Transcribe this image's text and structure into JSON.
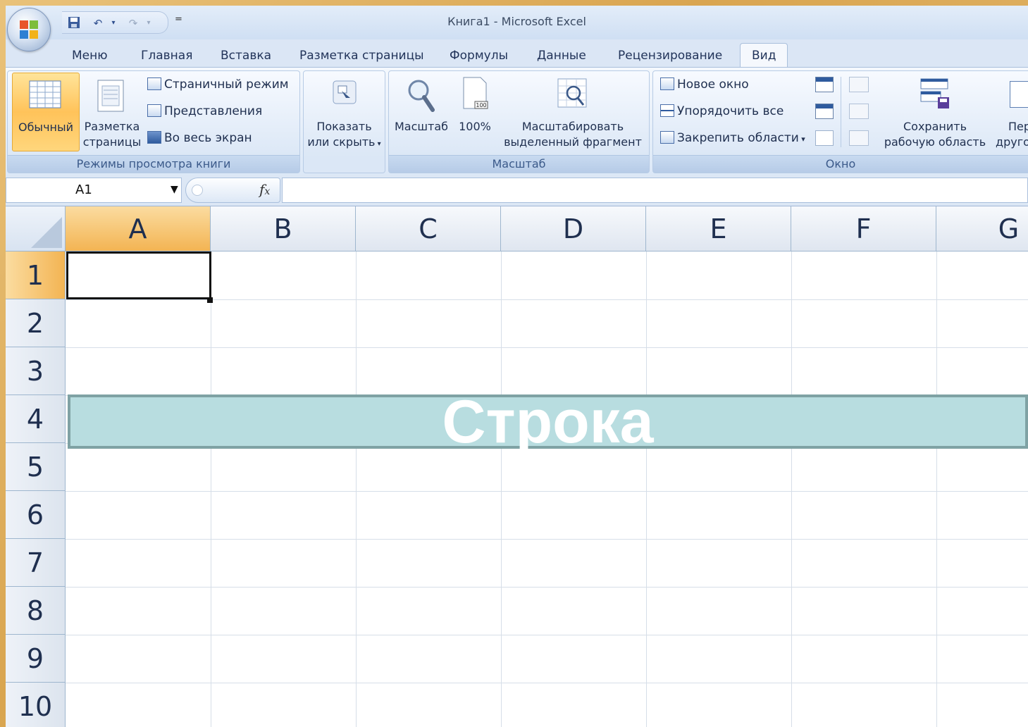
{
  "window": {
    "title": "Книга1 - Microsoft Excel"
  },
  "qat": {
    "save_icon": "save-icon",
    "undo_icon": "undo-icon",
    "redo_icon": "redo-icon",
    "customize": "="
  },
  "tabs": [
    {
      "label": "Меню"
    },
    {
      "label": "Главная"
    },
    {
      "label": "Вставка"
    },
    {
      "label": "Разметка страницы"
    },
    {
      "label": "Формулы"
    },
    {
      "label": "Данные"
    },
    {
      "label": "Рецензирование"
    },
    {
      "label": "Вид",
      "active": true
    }
  ],
  "ribbon": {
    "views": {
      "label": "Режимы просмотра книги",
      "normal": "Обычный",
      "page_layout_1": "Разметка",
      "page_layout_2": "страницы",
      "page_break": "Страничный режим",
      "custom_views": "Представления",
      "full_screen": "Во весь экран"
    },
    "show": {
      "line1": "Показать",
      "line2": "или скрыть"
    },
    "zoom": {
      "label": "Масштаб",
      "zoom": "Масштаб",
      "hundred": "100%",
      "icon_hundred": "100",
      "selection_1": "Масштабировать",
      "selection_2": "выделенный фрагмент"
    },
    "window": {
      "label": "Окно",
      "new_window": "Новое окно",
      "arrange_all": "Упорядочить все",
      "freeze": "Закрепить области",
      "save_ws_1": "Сохранить",
      "save_ws_2": "рабочую область",
      "switch_1": "Пер",
      "switch_2": "друго"
    }
  },
  "formula_bar": {
    "name_box": "A1",
    "fx": "fx",
    "value": ""
  },
  "columns": [
    "A",
    "B",
    "C",
    "D",
    "E",
    "F",
    "G"
  ],
  "rows": [
    "1",
    "2",
    "3",
    "4",
    "5",
    "6",
    "7",
    "8",
    "9",
    "10"
  ],
  "selected_cell": "A1",
  "highlight": {
    "text": "Строка",
    "row": "4"
  }
}
